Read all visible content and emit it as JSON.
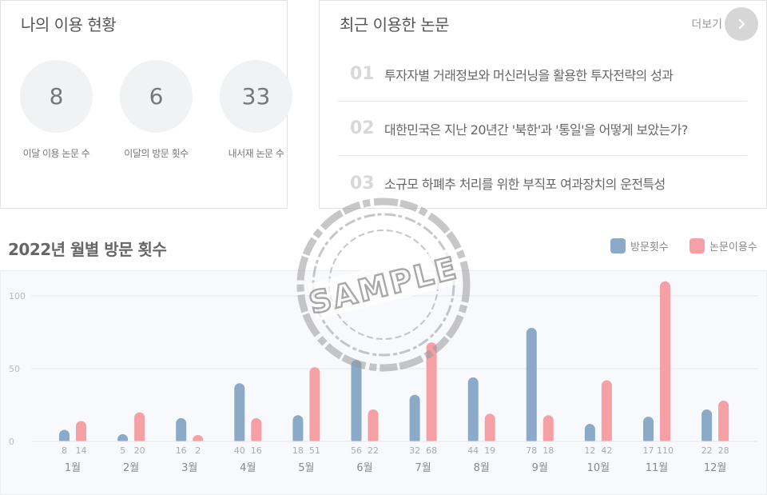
{
  "usage": {
    "title": "나의 이용 현황",
    "stats": [
      {
        "value": "8",
        "label": "이달 이용 논문 수"
      },
      {
        "value": "6",
        "label": "이달의 방문 횟수"
      },
      {
        "value": "33",
        "label": "내서재 논문 수"
      }
    ]
  },
  "recent": {
    "title": "최근 이용한 논문",
    "more_label": "더보기",
    "papers": [
      {
        "num": "01",
        "title": "투자자별 거래정보와 머신러닝을 활용한 투자전략의 성과"
      },
      {
        "num": "02",
        "title": "대한민국은 지난 20년간 '북한'과 '통일'을 어떻게 보았는가?"
      },
      {
        "num": "03",
        "title": "소규모 하폐추 처리를 위한 부직포 여과장치의 운전특성"
      }
    ]
  },
  "watermark": {
    "text": "SAMPLE"
  },
  "chart_data": {
    "type": "bar",
    "title": "2022년 월별 방문 횟수",
    "categories": [
      "1월",
      "2월",
      "3월",
      "4월",
      "5월",
      "6월",
      "7월",
      "8월",
      "9월",
      "10월",
      "11월",
      "12월"
    ],
    "series": [
      {
        "name": "방문횟수",
        "color": "#8aaac8",
        "values": [
          8,
          5,
          16,
          40,
          18,
          56,
          32,
          44,
          78,
          12,
          17,
          22
        ]
      },
      {
        "name": "논문이용수",
        "color": "#f5a0a4",
        "values": [
          14,
          20,
          2,
          16,
          51,
          22,
          68,
          19,
          18,
          42,
          110,
          28
        ]
      }
    ],
    "yticks": [
      0,
      50,
      100
    ],
    "ylim": [
      0,
      100
    ],
    "legend": "top-right",
    "grid": true
  }
}
